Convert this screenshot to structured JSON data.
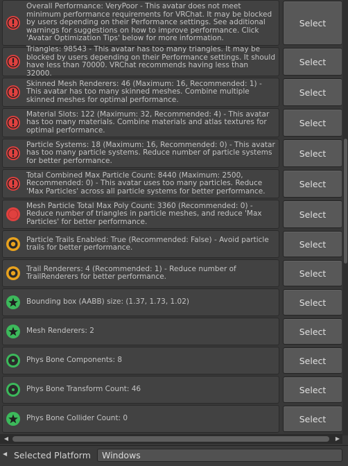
{
  "items": [
    {
      "severity": "error-icon",
      "text": "Overall Performance: VeryPoor - This avatar does not meet minimum performance requirements for VRChat. It may be blocked by users depending on their Performance settings. See additional warnings for suggestions on how to improve performance. Click 'Avatar Optimization Tips' below for more information.",
      "button": "Select"
    },
    {
      "severity": "error-icon",
      "text": "Triangles: 98543 - This avatar has too many triangles. It may be blocked by users depending on their Performance settings. It should have less than 70000. VRChat recommends having less than 32000.",
      "button": "Select"
    },
    {
      "severity": "error-icon",
      "text": "Skinned Mesh Renderers: 46 (Maximum: 16, Recommended: 1) - This avatar has too many skinned meshes. Combine multiple skinned meshes for optimal performance.",
      "button": "Select"
    },
    {
      "severity": "error-icon",
      "text": "Material Slots: 122 (Maximum: 32, Recommended: 4) - This avatar has too many materials. Combine materials and atlas textures for optimal performance.",
      "button": "Select"
    },
    {
      "severity": "error-icon",
      "text": "Particle Systems: 18 (Maximum: 16, Recommended: 0) - This avatar has too many particle systems. Reduce number of particle systems for better performance.",
      "button": "Select"
    },
    {
      "severity": "error-icon",
      "text": "Total Combined Max Particle Count: 8440 (Maximum: 2500, Recommended: 0) - This avatar uses too many particles. Reduce 'Max Particles' across all particle systems for better performance.",
      "button": "Select"
    },
    {
      "severity": "poor-icon",
      "text": "Mesh Particle Total Max Poly Count: 3360 (Recommended: 0) - Reduce number of triangles in particle meshes, and reduce 'Max Particles' for better performance.",
      "button": "Select"
    },
    {
      "severity": "medium-icon",
      "text": "Particle Trails Enabled: True (Recommended: False) - Avoid particle trails for better performance.",
      "button": "Select"
    },
    {
      "severity": "medium-icon",
      "text": "Trail Renderers: 4 (Recommended: 1) - Reduce number of TrailRenderers for better performance.",
      "button": "Select"
    },
    {
      "severity": "excellent-icon",
      "text": "Bounding box (AABB) size: (1.37, 1.73, 1.02)",
      "button": "Select"
    },
    {
      "severity": "excellent-icon",
      "text": "Mesh Renderers: 2",
      "button": "Select"
    },
    {
      "severity": "good-icon",
      "text": "Phys Bone Components: 8",
      "button": "Select"
    },
    {
      "severity": "good-icon",
      "text": "Phys Bone Transform Count: 46",
      "button": "Select"
    },
    {
      "severity": "excellent-icon",
      "text": "Phys Bone Collider Count: 0",
      "button": "Select"
    }
  ],
  "footer": {
    "label": "Selected Platform",
    "platform": "Windows"
  },
  "colors": {
    "error": "#e0413f",
    "medium": "#e8a21e",
    "good": "#3cb95b"
  }
}
